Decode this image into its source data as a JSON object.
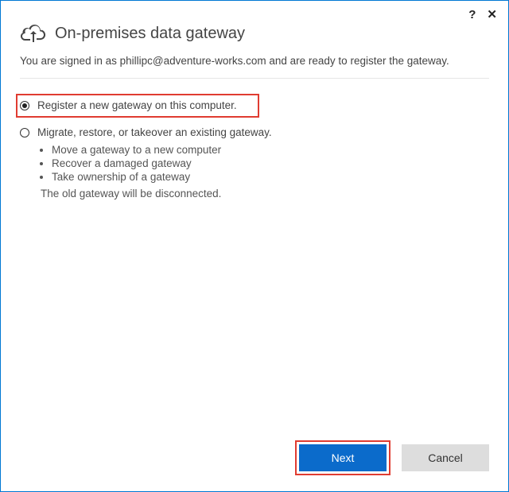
{
  "header": {
    "title": "On-premises data gateway"
  },
  "status": {
    "prefix": "You are signed in as ",
    "email": "phillipc@adventure-works.com",
    "suffix": " and are ready to register the gateway."
  },
  "options": {
    "register": {
      "label": "Register a new gateway on this computer.",
      "selected": true
    },
    "migrate": {
      "label": "Migrate, restore, or takeover an existing gateway.",
      "selected": false,
      "bullets": [
        "Move a gateway to a new computer",
        "Recover a damaged gateway",
        "Take ownership of a gateway"
      ],
      "note": "The old gateway will be disconnected."
    }
  },
  "buttons": {
    "next": "Next",
    "cancel": "Cancel"
  },
  "controls": {
    "help": "?",
    "close": "✕"
  }
}
